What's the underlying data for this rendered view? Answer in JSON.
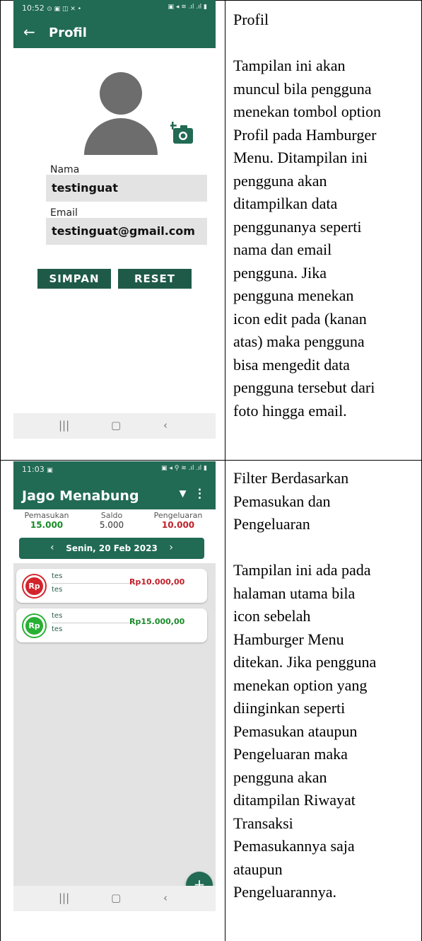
{
  "rows": [
    {
      "phone": {
        "status_time": "10:52",
        "app_title": "Profil",
        "name_label": "Nama",
        "name_value": "testinguat",
        "email_label": "Email",
        "email_value": "testinguat@gmail.com",
        "save_button": "SIMPAN",
        "reset_button": "RESET"
      },
      "description": [
        "Profil",
        "",
        "Tampilan ini akan",
        "muncul bila pengguna",
        "menekan tombol option",
        "Profil pada Hamburger",
        "Menu. Ditampilan ini",
        "pengguna akan",
        "ditampilkan data",
        "penggunanya seperti",
        "nama dan email",
        "pengguna. Jika",
        "pengguna menekan",
        "icon edit pada (kanan",
        "atas) maka pengguna",
        "bisa mengedit data",
        "pengguna tersebut dari",
        "foto hingga email."
      ]
    },
    {
      "phone": {
        "status_time": "11:03",
        "app_title": "Jago Menabung",
        "summary": [
          {
            "label": "Pemasukan",
            "value": "15.000",
            "color": "#1a8a2a"
          },
          {
            "label": "Saldo",
            "value": "5.000",
            "color": "#333333"
          },
          {
            "label": "Pengeluaran",
            "value": "10.000",
            "color": "#c0202a"
          }
        ],
        "date": "Senin, 20 Feb 2023",
        "transactions": [
          {
            "badge": "Rp",
            "title": "tes",
            "note": "tes",
            "amount": "Rp10.000,00",
            "color": "#d3242c"
          },
          {
            "badge": "Rp",
            "title": "tes",
            "note": "tes",
            "amount": "Rp15.000,00",
            "color": "#27b033"
          }
        ],
        "fab_label": "+"
      },
      "description": [
        "Filter Berdasarkan",
        "Pemasukan dan",
        "Pengeluaran",
        "",
        "Tampilan ini ada pada",
        "halaman utama bila",
        "icon sebelah",
        "Hamburger Menu",
        "ditekan. Jika pengguna",
        "menekan option yang",
        "diinginkan seperti",
        "Pemasukan ataupun",
        "Pengeluaran maka",
        "pengguna akan",
        "ditampilan Riwayat",
        "Transaksi",
        "Pemasukannya saja",
        "ataupun",
        "Pengeluarannya."
      ]
    }
  ],
  "colors": {
    "primary": "#216a54",
    "income": "#1a8a2a",
    "expense": "#c0202a"
  }
}
